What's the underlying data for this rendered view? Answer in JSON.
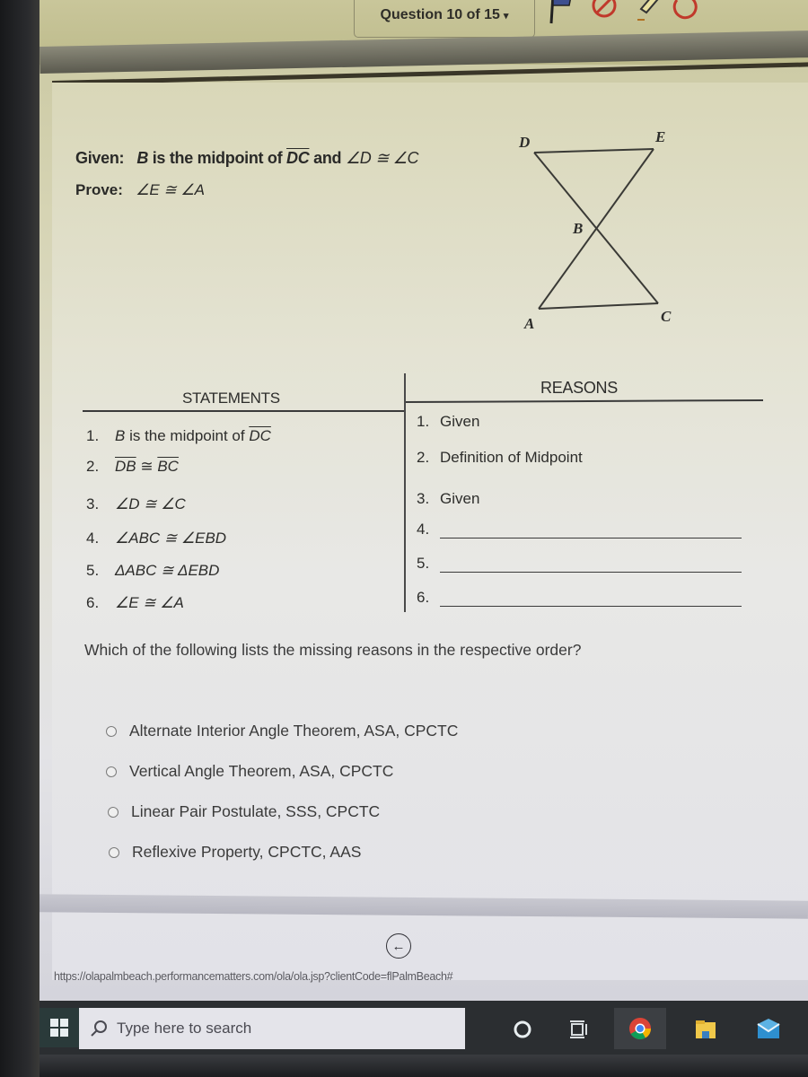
{
  "header": {
    "question_selector": "Question 10 of 15",
    "tools": [
      "flag-icon",
      "eliminate-icon",
      "highlighter-icon",
      "reset-icon"
    ]
  },
  "problem": {
    "given_label": "Given:",
    "given_point": "B",
    "given_text_1": " is the midpoint of ",
    "given_segment": "DC",
    "given_text_2": " and ",
    "given_angles": "∠D ≅ ∠C",
    "prove_label": "Prove:",
    "prove_statement": "∠E ≅ ∠A"
  },
  "diagram": {
    "labels": {
      "D": "D",
      "E": "E",
      "B": "B",
      "A": "A",
      "C": "C"
    },
    "segments": [
      "DE",
      "DC",
      "EA",
      "AC"
    ]
  },
  "proof": {
    "statements_header": "STATEMENTS",
    "reasons_header": "REASONS",
    "statements": [
      {
        "num": "1.",
        "text_point": "B",
        "text": " is the midpoint of ",
        "segment": "DC"
      },
      {
        "num": "2.",
        "seg1": "DB",
        "rel": " ≅ ",
        "seg2": "BC"
      },
      {
        "num": "3.",
        "text": "∠D ≅ ∠C"
      },
      {
        "num": "4.",
        "text": "∠ABC ≅ ∠EBD"
      },
      {
        "num": "5.",
        "text": "ΔABC ≅ ΔEBD"
      },
      {
        "num": "6.",
        "text": "∠E ≅ ∠A"
      }
    ],
    "reasons": [
      {
        "num": "1.",
        "text": "Given"
      },
      {
        "num": "2.",
        "text": "Definition of Midpoint"
      },
      {
        "num": "3.",
        "text": "Given"
      },
      {
        "num": "4.",
        "text": ""
      },
      {
        "num": "5.",
        "text": ""
      },
      {
        "num": "6.",
        "text": ""
      }
    ]
  },
  "question": {
    "prompt": "Which of the following lists the missing reasons in the respective order?",
    "options": [
      {
        "label": "Alternate Interior Angle Theorem, ASA, CPCTC",
        "selected": false
      },
      {
        "label": "Vertical Angle Theorem, ASA, CPCTC",
        "selected": false
      },
      {
        "label": "Linear Pair Postulate, SSS, CPCTC",
        "selected": false
      },
      {
        "label": "Reflexive Property, CPCTC, AAS",
        "selected": false
      }
    ]
  },
  "navigation": {
    "back_icon": "arrow-left-circle-icon"
  },
  "status_bar": {
    "url": "https://olapalmbeach.performancematters.com/ola/ola.jsp?clientCode=flPalmBeach#"
  },
  "taskbar": {
    "search_placeholder": "Type here to search",
    "icons": [
      "windows-start-icon",
      "cortana-icon",
      "task-view-icon",
      "chrome-icon",
      "file-explorer-icon",
      "mail-icon"
    ]
  },
  "colors": {
    "text": "#2d2d2b",
    "taskbar": "#2b2e31",
    "eliminate_red": "#c0392b",
    "flag_blue": "#3d4f8f"
  }
}
